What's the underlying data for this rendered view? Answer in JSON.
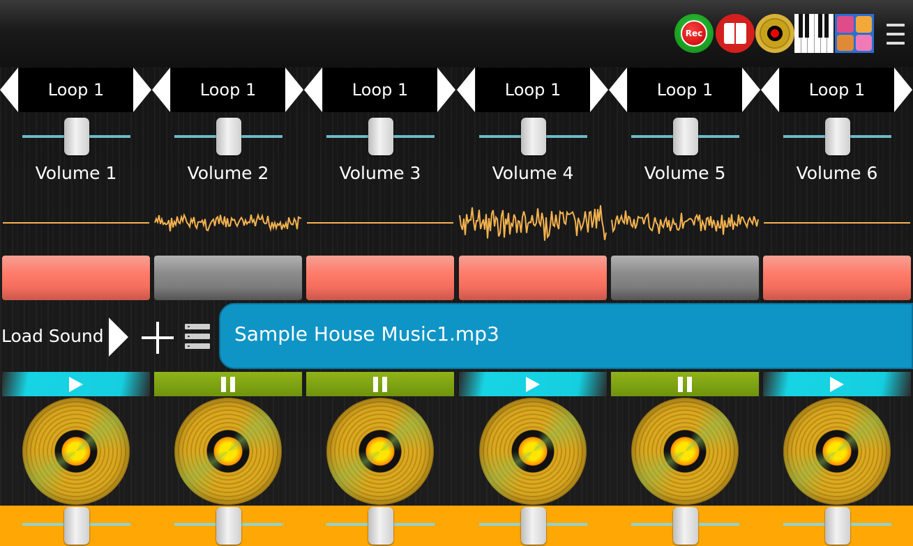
{
  "toolbar": {
    "rec_label": "Rec",
    "icons": [
      "record-icon",
      "book-icon",
      "vinyl-icon",
      "piano-icon",
      "pads-icon",
      "menu-icon"
    ],
    "pad_colors": [
      "#e04c8a",
      "#f3a83a",
      "#e08a35",
      "#f07ab8"
    ]
  },
  "tracks": [
    {
      "loop": "Loop 1",
      "volume_label": "Volume 1",
      "volume": 0.5,
      "bar_color": "pink",
      "state": "play",
      "pitch": 0.5,
      "has_waveform": false
    },
    {
      "loop": "Loop 1",
      "volume_label": "Volume 2",
      "volume": 0.5,
      "bar_color": "gray",
      "state": "pause",
      "pitch": 0.5,
      "has_waveform": true
    },
    {
      "loop": "Loop 1",
      "volume_label": "Volume 3",
      "volume": 0.5,
      "bar_color": "pink",
      "state": "pause",
      "pitch": 0.5,
      "has_waveform": false
    },
    {
      "loop": "Loop 1",
      "volume_label": "Volume 4",
      "volume": 0.5,
      "bar_color": "pink",
      "state": "play",
      "pitch": 0.5,
      "has_waveform": true
    },
    {
      "loop": "Loop 1",
      "volume_label": "Volume 5",
      "volume": 0.5,
      "bar_color": "gray",
      "state": "pause",
      "pitch": 0.5,
      "has_waveform": true
    },
    {
      "loop": "Loop 1",
      "volume_label": "Volume 6",
      "volume": 0.5,
      "bar_color": "pink",
      "state": "play",
      "pitch": 0.5,
      "has_waveform": false
    }
  ],
  "load": {
    "label": "Load Sound",
    "file_name": "Sample House Music1.mp3"
  },
  "colors": {
    "pink": "#ff7b6a",
    "gray": "#8b8b8b",
    "wave": "#f5b34f",
    "cyan": "#17d4e4",
    "green": "#7da415",
    "accent_orange": "#ffa805",
    "file_blue": "#0f94c6"
  }
}
